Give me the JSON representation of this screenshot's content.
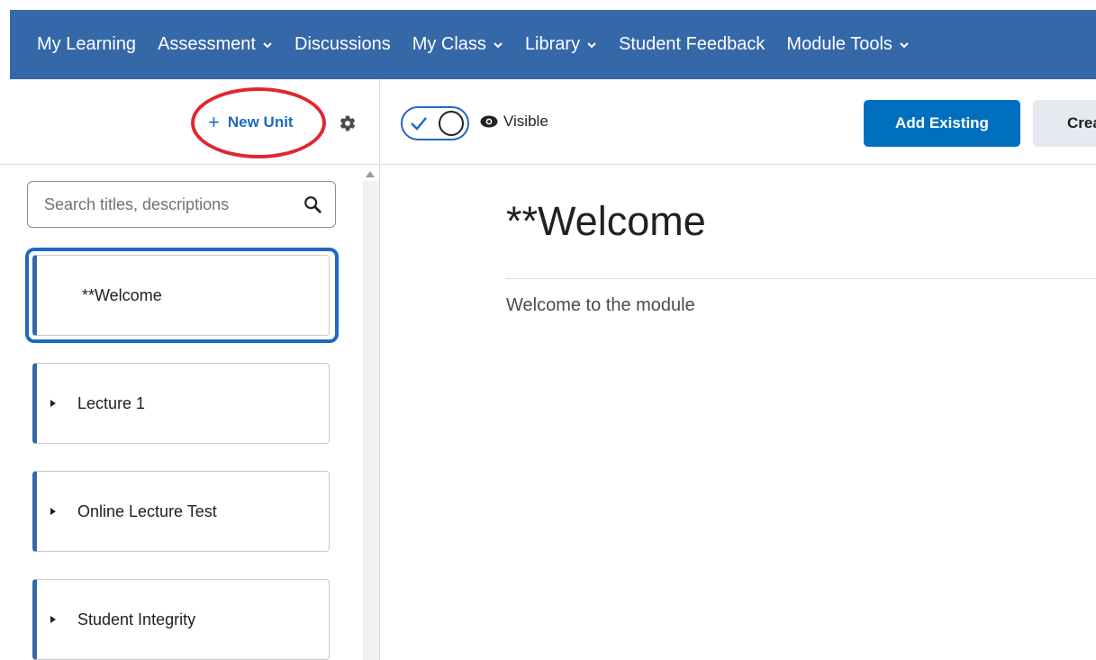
{
  "nav": {
    "items": [
      {
        "label": "My Learning",
        "dropdown": false
      },
      {
        "label": "Assessment",
        "dropdown": true
      },
      {
        "label": "Discussions",
        "dropdown": false
      },
      {
        "label": "My Class",
        "dropdown": true
      },
      {
        "label": "Library",
        "dropdown": true
      },
      {
        "label": "Student Feedback",
        "dropdown": false
      },
      {
        "label": "Module Tools",
        "dropdown": true
      }
    ],
    "color": "#3568a8"
  },
  "sidebar": {
    "new_unit_label": "New Unit",
    "new_unit_icon": "plus-icon",
    "settings_icon": "gear-icon",
    "search": {
      "placeholder": "Search titles, descriptions",
      "value": ""
    },
    "units": [
      {
        "title": "**Welcome",
        "expandable": false,
        "selected": true
      },
      {
        "title": "Lecture 1",
        "expandable": true,
        "selected": false
      },
      {
        "title": "Online Lecture Test",
        "expandable": true,
        "selected": false
      },
      {
        "title": "Student Integrity",
        "expandable": true,
        "selected": false
      }
    ]
  },
  "toolbar": {
    "visibility_label": "Visible",
    "visibility_on": true,
    "add_existing_label": "Add Existing",
    "create_label": "Crea"
  },
  "content": {
    "title": "**Welcome",
    "description": "Welcome to the module"
  },
  "colors": {
    "accent": "#1d6ac3",
    "primary_button": "#006fbf",
    "annotation": "#e2262e"
  }
}
